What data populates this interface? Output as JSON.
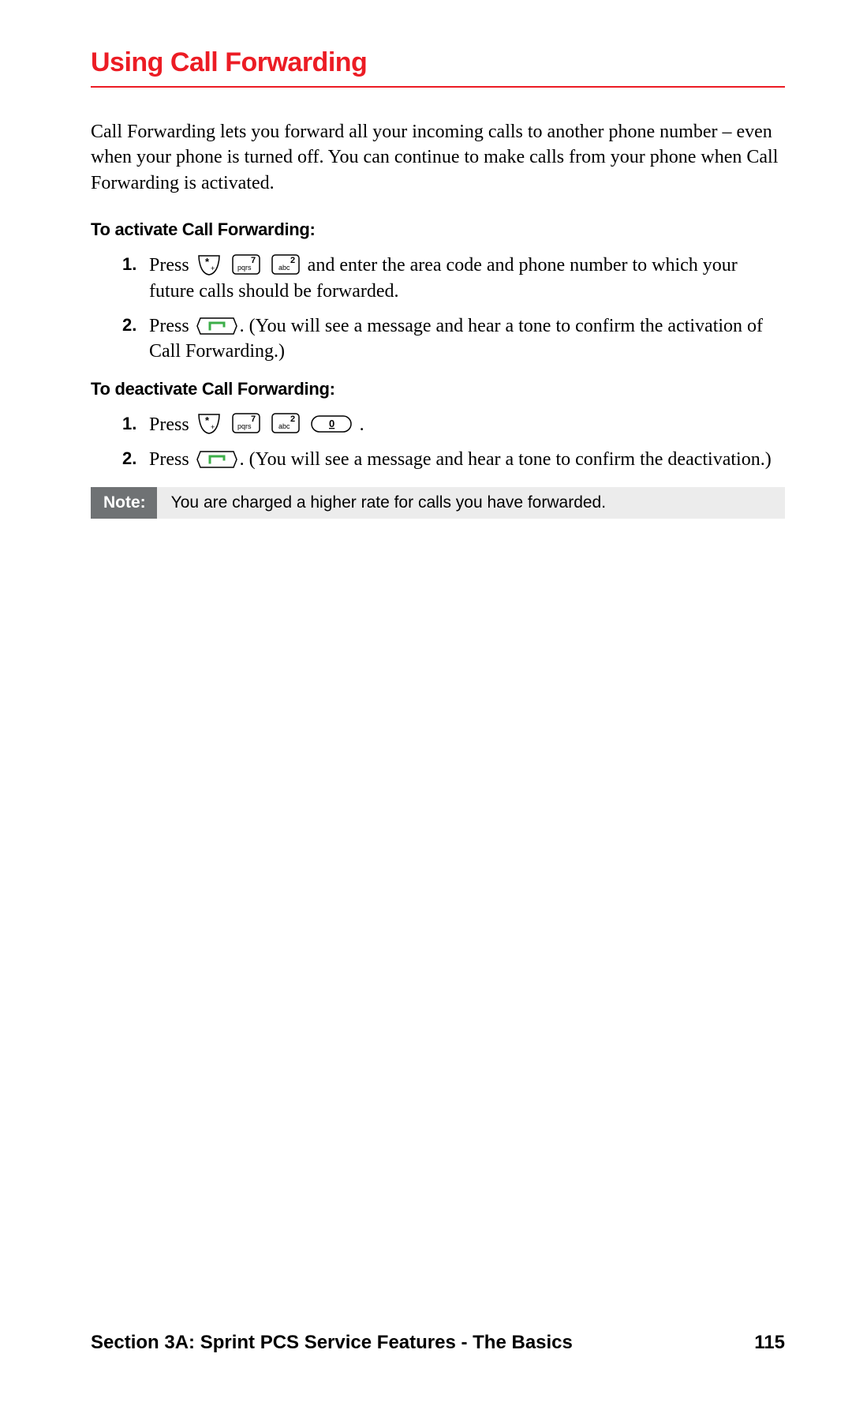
{
  "title": "Using Call Forwarding",
  "intro": "Call Forwarding lets you forward all your incoming calls to another phone number – even when your phone is turned off. You can continue to make calls from your phone when Call Forwarding is activated.",
  "activate": {
    "heading": "To activate Call Forwarding:",
    "step1_pre": "Press ",
    "step1_post": " and enter the area code and phone number to which your future calls should be forwarded.",
    "step2_pre": "Press ",
    "step2_post": ". (You will see a message and hear a tone to confirm the activation of Call Forwarding.)"
  },
  "deactivate": {
    "heading": "To deactivate Call Forwarding:",
    "step1_pre": "Press ",
    "step1_post": " .",
    "step2_pre": "Press ",
    "step2_post": ". (You will see a message and hear a tone to confirm the deactivation.)"
  },
  "keys": {
    "star_main": "*",
    "star_sub": "+",
    "seven_main": "7",
    "seven_sub": "pqrs",
    "two_main": "2",
    "two_sub": "abc",
    "zero_main": "0"
  },
  "note": {
    "label": "Note:",
    "text": "You are charged a higher rate for calls you have forwarded."
  },
  "footer": {
    "section": "Section 3A: Sprint PCS Service Features - The Basics",
    "page": "115"
  }
}
